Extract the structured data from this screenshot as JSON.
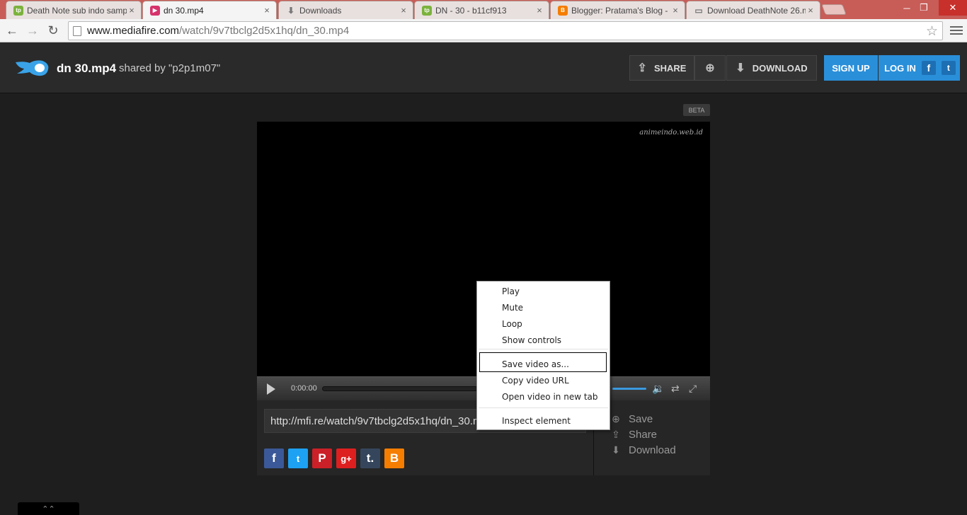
{
  "browser": {
    "tabs": [
      {
        "title": "Death Note sub indo samp",
        "favicon": "tp",
        "favicon_color": "#7bb23c"
      },
      {
        "title": "dn 30.mp4",
        "favicon": "▶",
        "favicon_color": "#d6336c"
      },
      {
        "title": "Downloads",
        "favicon": "⬇",
        "favicon_color": "#888888"
      },
      {
        "title": "DN - 30 - b11cf913",
        "favicon": "tp",
        "favicon_color": "#7bb23c"
      },
      {
        "title": "Blogger: Pratama's Blog -",
        "favicon": "B",
        "favicon_color": "#f57d00"
      },
      {
        "title": "Download DeathNote 26.m",
        "favicon": "▭",
        "favicon_color": "#888888"
      }
    ],
    "url_domain": "www.mediafire.com",
    "url_path": "/watch/9v7tbclg2d5x1hq/dn_30.mp4"
  },
  "header": {
    "filename": "dn 30.mp4",
    "shared_by": "shared by \"p2p1m07\"",
    "share_label": "SHARE",
    "download_label": "DOWNLOAD",
    "signup_label": "SIGN UP",
    "login_label": "LOG IN",
    "brand_color": "#2a8fd9"
  },
  "page": {
    "beta_badge": "BETA",
    "watermark": "animeindo.web.id",
    "player": {
      "time": "0:00:00"
    },
    "short_url": "http://mfi.re/watch/9v7tbclg2d5x1hq/dn_30.mp4",
    "actions": {
      "save": "Save",
      "share": "Share",
      "download": "Download"
    }
  },
  "context_menu": {
    "items": [
      "Play",
      "Mute",
      "Loop",
      "Show controls",
      "Save video as...",
      "Copy video URL",
      "Open video in new tab",
      "Inspect element"
    ]
  }
}
